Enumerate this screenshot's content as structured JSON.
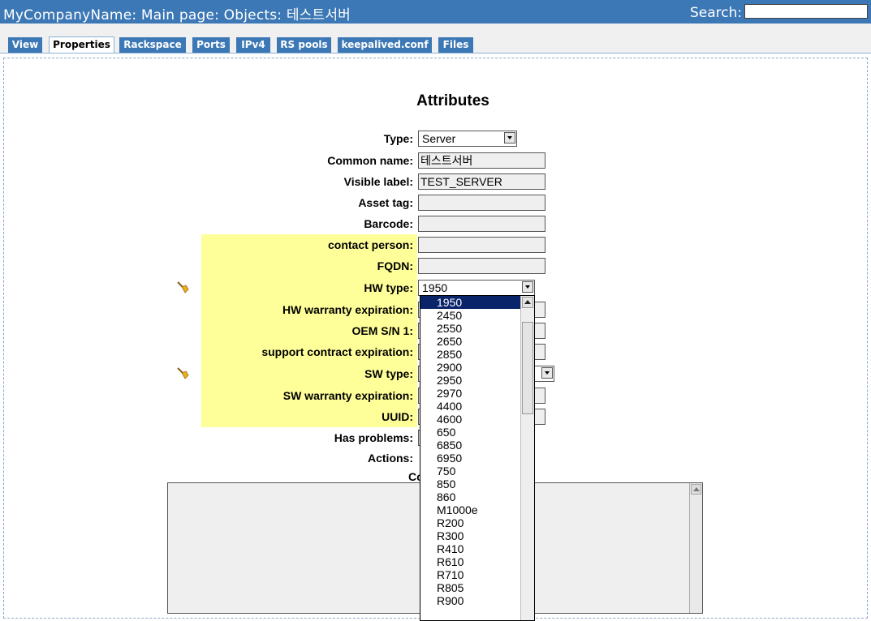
{
  "header": {
    "title": "MyCompanyName: Main page: Objects: 테스트서버",
    "search_label": "Search:",
    "search_value": ""
  },
  "tabs": [
    {
      "label": "View",
      "active": false
    },
    {
      "label": "Properties",
      "active": true
    },
    {
      "label": "Rackspace",
      "active": false
    },
    {
      "label": "Ports",
      "active": false
    },
    {
      "label": "IPv4",
      "active": false
    },
    {
      "label": "RS pools",
      "active": false
    },
    {
      "label": "keepalived.conf",
      "active": false
    },
    {
      "label": "Files",
      "active": false
    }
  ],
  "form": {
    "heading": "Attributes",
    "type_label": "Type:",
    "type_value": "Server",
    "common_name_label": "Common name:",
    "common_name_value": "테스트서버",
    "visible_label_label": "Visible label:",
    "visible_label_value": "TEST_SERVER",
    "asset_tag_label": "Asset tag:",
    "asset_tag_value": "",
    "barcode_label": "Barcode:",
    "barcode_value": "",
    "contact_person_label": "contact person:",
    "contact_person_value": "",
    "fqdn_label": "FQDN:",
    "fqdn_value": "",
    "hw_type_label": "HW type:",
    "hw_type_value": "1950",
    "hw_warranty_label": "HW warranty expiration:",
    "oem_sn_label": "OEM S/N 1:",
    "support_contract_label": "support contract expiration:",
    "sw_type_label": "SW type:",
    "sw_warranty_label": "SW warranty expiration:",
    "uuid_label": "UUID:",
    "has_problems_label": "Has problems:",
    "actions_label": "Actions:",
    "comment_label": "Co"
  },
  "hw_type_dropdown": {
    "selected": "1950",
    "options": [
      "1950",
      "2450",
      "2550",
      "2650",
      "2850",
      "2900",
      "2950",
      "2970",
      "4400",
      "4600",
      "650",
      "6850",
      "6950",
      "750",
      "850",
      "860",
      "M1000e",
      "R200",
      "R300",
      "R410",
      "R610",
      "R710",
      "R805",
      "R900"
    ]
  },
  "colors": {
    "header_bg": "#3c78b5",
    "yellow_highlight": "#ffff99",
    "selected_option_bg": "#0a246a"
  },
  "icons": {
    "clear_hw_type": "broom-icon",
    "clear_sw_type": "broom-icon"
  }
}
